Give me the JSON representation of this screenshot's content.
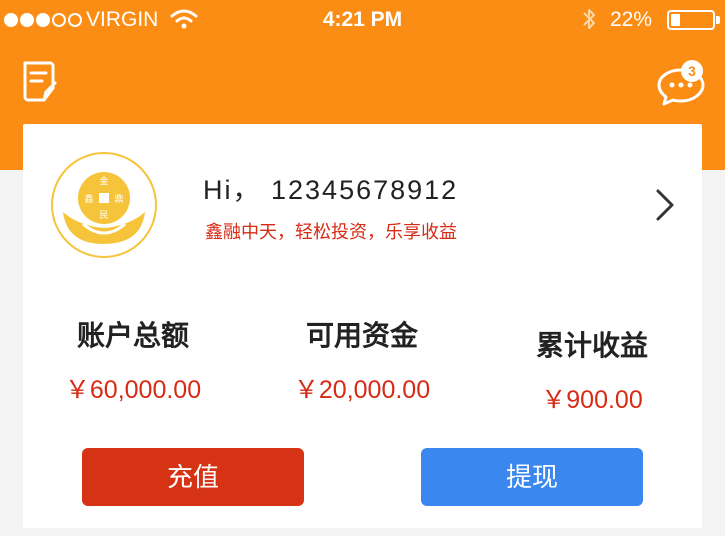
{
  "status_bar": {
    "carrier": "VIRGIN",
    "time": "4:21 PM",
    "battery_percent": "22%",
    "battery_level": 0.22,
    "signal_bars_filled": 3,
    "signal_bars_total": 5
  },
  "nav": {
    "left_icon": "notebook-icon",
    "right_icon": "message-bubble-icon",
    "message_badge": "3"
  },
  "profile": {
    "greeting": "Hi，  12345678912",
    "slogan": "鑫融中天，轻松投资，乐享收益",
    "avatar_icon": "coin-logo-icon",
    "avatar_text": [
      "金",
      "鑫",
      "鼎",
      "民"
    ]
  },
  "stats": [
    {
      "label": "账户总额",
      "value": "￥60,000.00"
    },
    {
      "label": "可用资金",
      "value": "￥20,000.00"
    },
    {
      "label": "累计收益",
      "value": "￥900.00"
    }
  ],
  "actions": {
    "recharge_label": "充值",
    "withdraw_label": "提现"
  },
  "colors": {
    "brand_orange": "#fb8d14",
    "accent_red": "#d72b15",
    "recharge_red": "#d63315",
    "withdraw_blue": "#3a87f0",
    "avatar_gold": "#f5c43b"
  }
}
